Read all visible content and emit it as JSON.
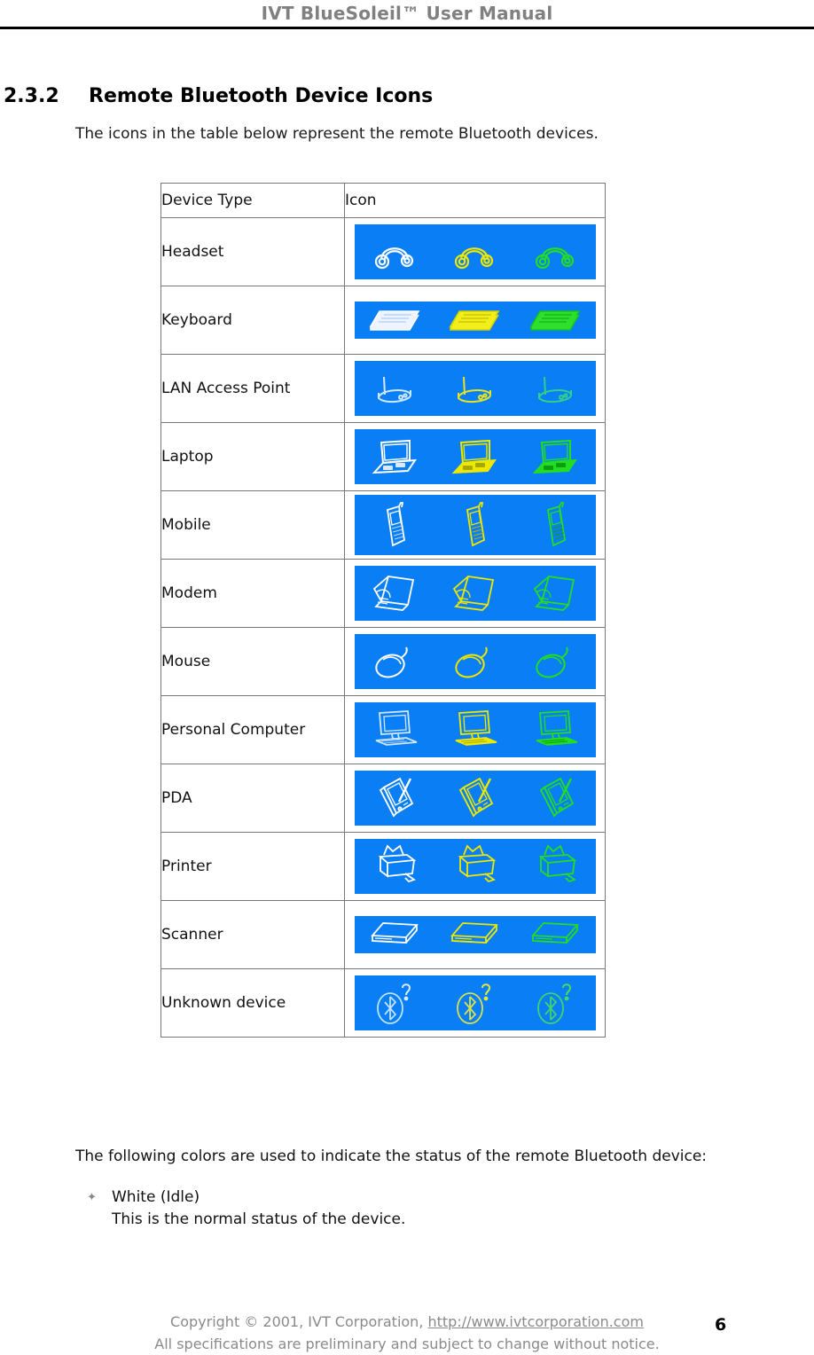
{
  "header": {
    "title": "IVT BlueSoleil™ User Manual"
  },
  "section": {
    "number": "2.3.2",
    "title": "Remote Bluetooth Device Icons",
    "intro": "The icons in the table below represent the remote Bluetooth devices."
  },
  "table": {
    "columns": [
      "Device Type",
      "Icon"
    ],
    "rows": [
      {
        "device_type": "Headset",
        "icon": "headset-icon"
      },
      {
        "device_type": "Keyboard",
        "icon": "keyboard-icon"
      },
      {
        "device_type": "LAN Access Point",
        "icon": "lan-access-point-icon"
      },
      {
        "device_type": "Laptop",
        "icon": "laptop-icon"
      },
      {
        "device_type": "Mobile",
        "icon": "mobile-phone-icon"
      },
      {
        "device_type": "Modem",
        "icon": "modem-icon"
      },
      {
        "device_type": "Mouse",
        "icon": "mouse-icon"
      },
      {
        "device_type": "Personal Computer",
        "icon": "personal-computer-icon"
      },
      {
        "device_type": "PDA",
        "icon": "pda-icon"
      },
      {
        "device_type": "Printer",
        "icon": "printer-icon"
      },
      {
        "device_type": "Scanner",
        "icon": "scanner-icon"
      },
      {
        "device_type": "Unknown device",
        "icon": "unknown-device-icon"
      }
    ]
  },
  "status": {
    "intro": "The following colors are used to indicate the status of the remote Bluetooth device:",
    "items": [
      {
        "label": "White (Idle)",
        "description": "This is the normal status of the device."
      }
    ]
  },
  "footer": {
    "copyright_prefix": "Copyright © 2001, IVT Corporation, ",
    "url": "http://www.ivtcorporation.com",
    "disclaimer": "All specifications are preliminary and subject to change without notice.",
    "page_number": "6"
  },
  "colors": {
    "icon_background": "#0a7ef5",
    "variant_white": "#ffffff",
    "variant_yellow": "#ece800",
    "variant_green": "#22dd22",
    "header_text": "#808080",
    "footer_text": "#8a8a8a",
    "table_border": "#777777"
  }
}
